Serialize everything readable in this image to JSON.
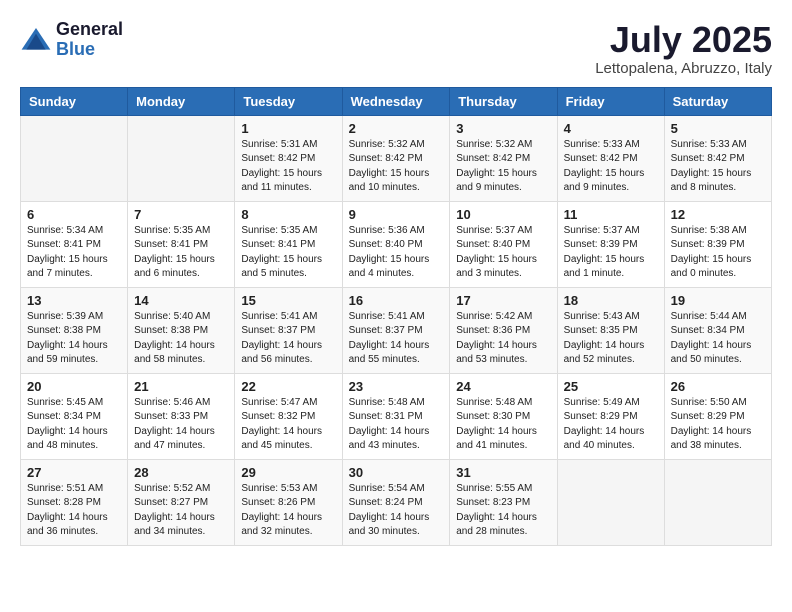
{
  "header": {
    "logo_general": "General",
    "logo_blue": "Blue",
    "month_title": "July 2025",
    "location": "Lettopalena, Abruzzo, Italy"
  },
  "weekdays": [
    "Sunday",
    "Monday",
    "Tuesday",
    "Wednesday",
    "Thursday",
    "Friday",
    "Saturday"
  ],
  "weeks": [
    [
      {
        "day": "",
        "info": ""
      },
      {
        "day": "",
        "info": ""
      },
      {
        "day": "1",
        "info": "Sunrise: 5:31 AM\nSunset: 8:42 PM\nDaylight: 15 hours and 11 minutes."
      },
      {
        "day": "2",
        "info": "Sunrise: 5:32 AM\nSunset: 8:42 PM\nDaylight: 15 hours and 10 minutes."
      },
      {
        "day": "3",
        "info": "Sunrise: 5:32 AM\nSunset: 8:42 PM\nDaylight: 15 hours and 9 minutes."
      },
      {
        "day": "4",
        "info": "Sunrise: 5:33 AM\nSunset: 8:42 PM\nDaylight: 15 hours and 9 minutes."
      },
      {
        "day": "5",
        "info": "Sunrise: 5:33 AM\nSunset: 8:42 PM\nDaylight: 15 hours and 8 minutes."
      }
    ],
    [
      {
        "day": "6",
        "info": "Sunrise: 5:34 AM\nSunset: 8:41 PM\nDaylight: 15 hours and 7 minutes."
      },
      {
        "day": "7",
        "info": "Sunrise: 5:35 AM\nSunset: 8:41 PM\nDaylight: 15 hours and 6 minutes."
      },
      {
        "day": "8",
        "info": "Sunrise: 5:35 AM\nSunset: 8:41 PM\nDaylight: 15 hours and 5 minutes."
      },
      {
        "day": "9",
        "info": "Sunrise: 5:36 AM\nSunset: 8:40 PM\nDaylight: 15 hours and 4 minutes."
      },
      {
        "day": "10",
        "info": "Sunrise: 5:37 AM\nSunset: 8:40 PM\nDaylight: 15 hours and 3 minutes."
      },
      {
        "day": "11",
        "info": "Sunrise: 5:37 AM\nSunset: 8:39 PM\nDaylight: 15 hours and 1 minute."
      },
      {
        "day": "12",
        "info": "Sunrise: 5:38 AM\nSunset: 8:39 PM\nDaylight: 15 hours and 0 minutes."
      }
    ],
    [
      {
        "day": "13",
        "info": "Sunrise: 5:39 AM\nSunset: 8:38 PM\nDaylight: 14 hours and 59 minutes."
      },
      {
        "day": "14",
        "info": "Sunrise: 5:40 AM\nSunset: 8:38 PM\nDaylight: 14 hours and 58 minutes."
      },
      {
        "day": "15",
        "info": "Sunrise: 5:41 AM\nSunset: 8:37 PM\nDaylight: 14 hours and 56 minutes."
      },
      {
        "day": "16",
        "info": "Sunrise: 5:41 AM\nSunset: 8:37 PM\nDaylight: 14 hours and 55 minutes."
      },
      {
        "day": "17",
        "info": "Sunrise: 5:42 AM\nSunset: 8:36 PM\nDaylight: 14 hours and 53 minutes."
      },
      {
        "day": "18",
        "info": "Sunrise: 5:43 AM\nSunset: 8:35 PM\nDaylight: 14 hours and 52 minutes."
      },
      {
        "day": "19",
        "info": "Sunrise: 5:44 AM\nSunset: 8:34 PM\nDaylight: 14 hours and 50 minutes."
      }
    ],
    [
      {
        "day": "20",
        "info": "Sunrise: 5:45 AM\nSunset: 8:34 PM\nDaylight: 14 hours and 48 minutes."
      },
      {
        "day": "21",
        "info": "Sunrise: 5:46 AM\nSunset: 8:33 PM\nDaylight: 14 hours and 47 minutes."
      },
      {
        "day": "22",
        "info": "Sunrise: 5:47 AM\nSunset: 8:32 PM\nDaylight: 14 hours and 45 minutes."
      },
      {
        "day": "23",
        "info": "Sunrise: 5:48 AM\nSunset: 8:31 PM\nDaylight: 14 hours and 43 minutes."
      },
      {
        "day": "24",
        "info": "Sunrise: 5:48 AM\nSunset: 8:30 PM\nDaylight: 14 hours and 41 minutes."
      },
      {
        "day": "25",
        "info": "Sunrise: 5:49 AM\nSunset: 8:29 PM\nDaylight: 14 hours and 40 minutes."
      },
      {
        "day": "26",
        "info": "Sunrise: 5:50 AM\nSunset: 8:29 PM\nDaylight: 14 hours and 38 minutes."
      }
    ],
    [
      {
        "day": "27",
        "info": "Sunrise: 5:51 AM\nSunset: 8:28 PM\nDaylight: 14 hours and 36 minutes."
      },
      {
        "day": "28",
        "info": "Sunrise: 5:52 AM\nSunset: 8:27 PM\nDaylight: 14 hours and 34 minutes."
      },
      {
        "day": "29",
        "info": "Sunrise: 5:53 AM\nSunset: 8:26 PM\nDaylight: 14 hours and 32 minutes."
      },
      {
        "day": "30",
        "info": "Sunrise: 5:54 AM\nSunset: 8:24 PM\nDaylight: 14 hours and 30 minutes."
      },
      {
        "day": "31",
        "info": "Sunrise: 5:55 AM\nSunset: 8:23 PM\nDaylight: 14 hours and 28 minutes."
      },
      {
        "day": "",
        "info": ""
      },
      {
        "day": "",
        "info": ""
      }
    ]
  ]
}
